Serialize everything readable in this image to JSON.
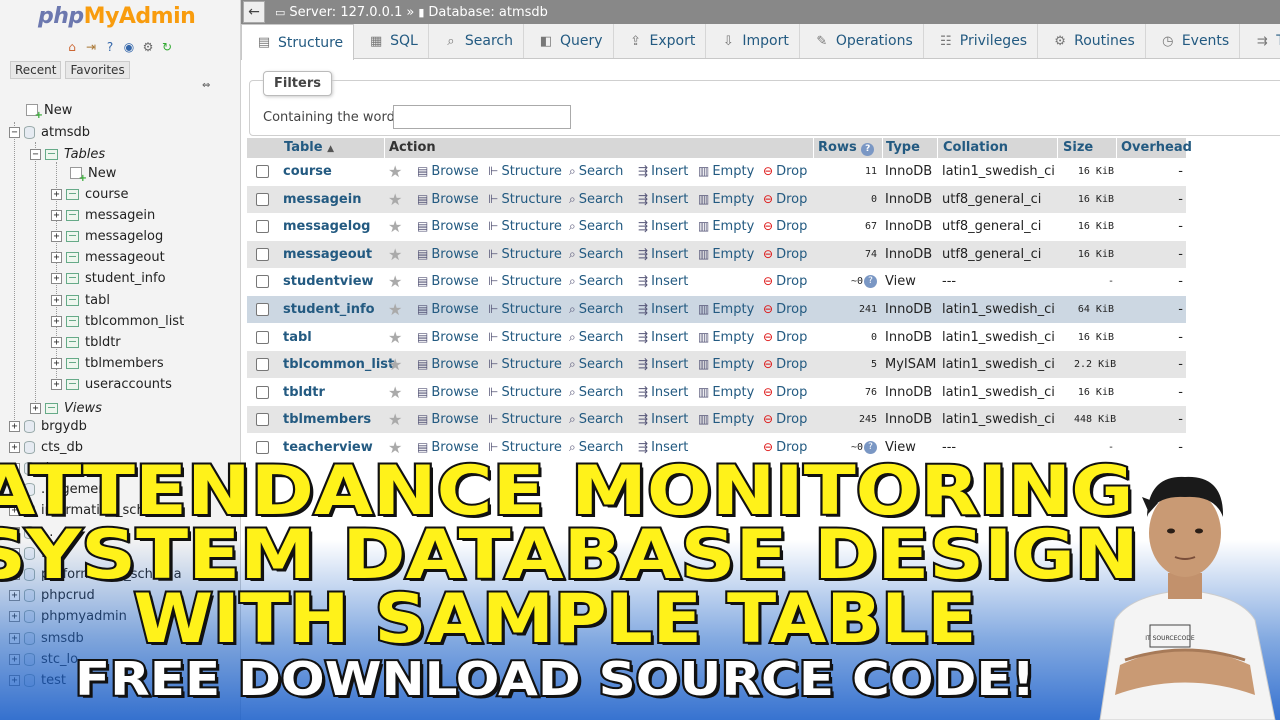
{
  "logo": {
    "php": "php",
    "myadmin": "MyAdmin"
  },
  "nav": {
    "icons": [
      "home-icon",
      "exit-icon",
      "help-icon",
      "docs-icon",
      "settings-icon",
      "reload-icon"
    ],
    "recent": "Recent",
    "favorites": "Favorites",
    "tree": {
      "new": "New",
      "db_open": "atmsdb",
      "tables_label": "Tables",
      "tables_new": "New",
      "tables": [
        "course",
        "messagein",
        "messagelog",
        "messageout",
        "student_info",
        "tabl",
        "tblcommon_list",
        "tbldtr",
        "tblmembers",
        "useraccounts"
      ],
      "views_label": "Views",
      "other_dbs": [
        "brgydb",
        "cts_db",
        "d...",
        "...agement",
        "information_schema",
        "...",
        "...",
        "performance_schema",
        "phpcrud",
        "phpmyadmin",
        "smsdb",
        "stc_lo...",
        "test"
      ]
    }
  },
  "breadcrumb": {
    "server": "Server: 127.0.0.1",
    "sep": "»",
    "database": "Database: atmsdb"
  },
  "tabs": [
    {
      "label": "Structure",
      "icon": "structure-icon"
    },
    {
      "label": "SQL",
      "icon": "sql-icon"
    },
    {
      "label": "Search",
      "icon": "search-icon"
    },
    {
      "label": "Query",
      "icon": "query-icon"
    },
    {
      "label": "Export",
      "icon": "export-icon"
    },
    {
      "label": "Import",
      "icon": "import-icon"
    },
    {
      "label": "Operations",
      "icon": "wrench-icon"
    },
    {
      "label": "Privileges",
      "icon": "privileges-icon"
    },
    {
      "label": "Routines",
      "icon": "routines-icon"
    },
    {
      "label": "Events",
      "icon": "events-icon"
    },
    {
      "label": "Trigger",
      "icon": "triggers-icon"
    }
  ],
  "filters": {
    "legend": "Filters",
    "label": "Containing the word:",
    "value": ""
  },
  "table": {
    "headers": {
      "table": "Table",
      "action": "Action",
      "rows": "Rows",
      "type": "Type",
      "collation": "Collation",
      "size": "Size",
      "overhead": "Overhead"
    },
    "actions": {
      "browse": "Browse",
      "structure": "Structure",
      "search": "Search",
      "insert": "Insert",
      "empty": "Empty",
      "drop": "Drop"
    },
    "rows": [
      {
        "name": "course",
        "rows": "11",
        "type": "InnoDB",
        "collation": "latin1_swedish_ci",
        "size": "16 KiB",
        "overhead": "-"
      },
      {
        "name": "messagein",
        "rows": "0",
        "type": "InnoDB",
        "collation": "utf8_general_ci",
        "size": "16 KiB",
        "overhead": "-"
      },
      {
        "name": "messagelog",
        "rows": "67",
        "type": "InnoDB",
        "collation": "utf8_general_ci",
        "size": "16 KiB",
        "overhead": "-"
      },
      {
        "name": "messageout",
        "rows": "74",
        "type": "InnoDB",
        "collation": "utf8_general_ci",
        "size": "16 KiB",
        "overhead": "-"
      },
      {
        "name": "studentview",
        "rows": "~0",
        "type": "View",
        "collation": "---",
        "size": "-",
        "overhead": "-",
        "view": true
      },
      {
        "name": "student_info",
        "rows": "241",
        "type": "InnoDB",
        "collation": "latin1_swedish_ci",
        "size": "64 KiB",
        "overhead": "-"
      },
      {
        "name": "tabl",
        "rows": "0",
        "type": "InnoDB",
        "collation": "latin1_swedish_ci",
        "size": "16 KiB",
        "overhead": "-"
      },
      {
        "name": "tblcommon_list",
        "rows": "5",
        "type": "MyISAM",
        "collation": "latin1_swedish_ci",
        "size": "2.2 KiB",
        "overhead": "-"
      },
      {
        "name": "tbldtr",
        "rows": "76",
        "type": "InnoDB",
        "collation": "latin1_swedish_ci",
        "size": "16 KiB",
        "overhead": "-"
      },
      {
        "name": "tblmembers",
        "rows": "245",
        "type": "InnoDB",
        "collation": "latin1_swedish_ci",
        "size": "448 KiB",
        "overhead": "-"
      },
      {
        "name": "teacherview",
        "rows": "~0",
        "type": "View",
        "collation": "---",
        "size": "-",
        "overhead": "-",
        "view": true
      }
    ]
  },
  "overlay": {
    "line1": "ATTENDANCE MONITORING",
    "line2": "SYSTEM DATABASE DESIGN",
    "line3": "WITH SAMPLE TABLE",
    "line4": "FREE DOWNLOAD SOURCE CODE!",
    "shirt_text": "IT SOURCECODE"
  },
  "colors": {
    "link": "#235a81",
    "overlay_yellow": "#fff21a",
    "drop_red": "#dd1111",
    "header_gray": "#d7d7d7",
    "selected_row": "#ccd7e2"
  }
}
